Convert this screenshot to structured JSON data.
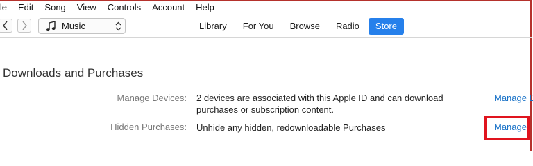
{
  "menubar": {
    "items": [
      "ile",
      "Edit",
      "Song",
      "View",
      "Controls",
      "Account",
      "Help"
    ]
  },
  "toolbar": {
    "back_icon": "chevron-left-icon",
    "forward_icon": "chevron-right-icon",
    "media_select": {
      "icon": "music-note-icon",
      "value": "Music"
    },
    "tabs": [
      {
        "label": "Library",
        "active": false
      },
      {
        "label": "For You",
        "active": false
      },
      {
        "label": "Browse",
        "active": false
      },
      {
        "label": "Radio",
        "active": false
      },
      {
        "label": "Store",
        "active": true
      }
    ],
    "active_tab_color": "#2680eb"
  },
  "main": {
    "section_title": "Downloads and Purchases",
    "rows": [
      {
        "label": "Manage Devices:",
        "value": "2 devices are associated with this Apple ID and can download purchases or subscription content.",
        "action": "Manage D"
      },
      {
        "label": "Hidden Purchases:",
        "value": "Unhide any hidden, redownloadable Purchases",
        "action": "Manage"
      }
    ],
    "link_color": "#1a73c8",
    "highlight_color": "#e0141e"
  }
}
